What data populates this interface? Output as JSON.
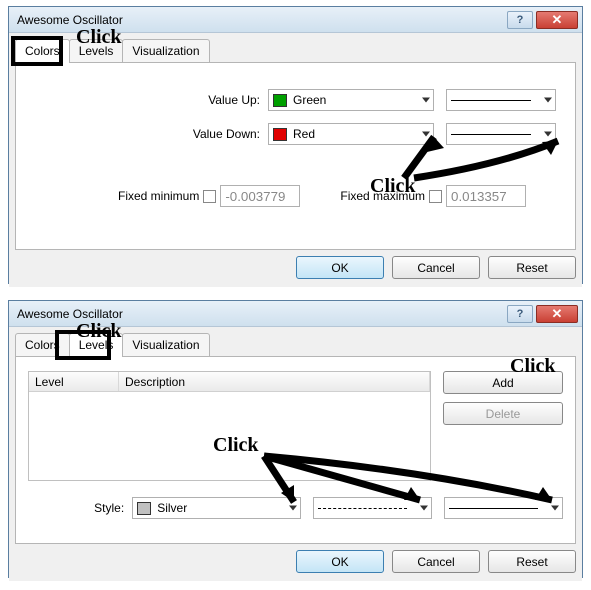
{
  "dialog1": {
    "title": "Awesome Oscillator",
    "tabs": {
      "colors": "Colors",
      "levels": "Levels",
      "visualization": "Visualization"
    },
    "value_up_label": "Value Up:",
    "value_up_color_name": "Green",
    "value_up_color": "#00a000",
    "value_down_label": "Value Down:",
    "value_down_color_name": "Red",
    "value_down_color": "#e00000",
    "fixed_min_label": "Fixed minimum",
    "fixed_min_value": "-0.003779",
    "fixed_max_label": "Fixed maximum",
    "fixed_max_value": "0.013357",
    "buttons": {
      "ok": "OK",
      "cancel": "Cancel",
      "reset": "Reset"
    }
  },
  "dialog2": {
    "title": "Awesome Oscillator",
    "tabs": {
      "colors": "Colors",
      "levels": "Levels",
      "visualization": "Visualization"
    },
    "list_headers": {
      "level": "Level",
      "description": "Description"
    },
    "side_buttons": {
      "add": "Add",
      "delete": "Delete"
    },
    "style_label": "Style:",
    "style_color_name": "Silver",
    "style_color": "#c0c0c0",
    "buttons": {
      "ok": "OK",
      "cancel": "Cancel",
      "reset": "Reset"
    }
  },
  "annotations": {
    "click": "Click"
  }
}
